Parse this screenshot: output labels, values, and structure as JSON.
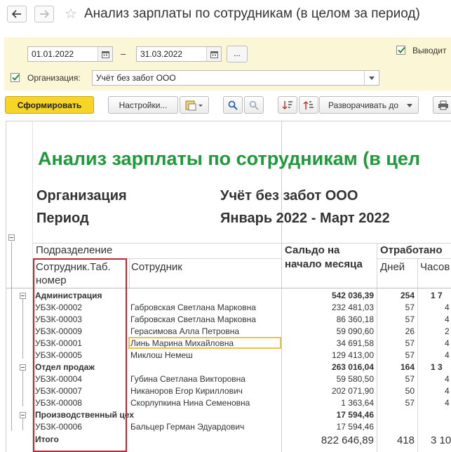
{
  "window": {
    "title": "Анализ зарплаты по сотрудникам (в целом за период)"
  },
  "params": {
    "date_from": "01.01.2022",
    "date_to": "31.03.2022",
    "dash": "–",
    "more_btn": "...",
    "output_label": "Выводит",
    "org_label": "Организация:",
    "org_value": "Учёт без забот ООО"
  },
  "toolbar": {
    "generate": "Сформировать",
    "settings": "Настройки...",
    "expand": "Разворачивать до"
  },
  "report": {
    "title": "Анализ зарплаты по сотрудникам (в цел",
    "org_label": "Организация",
    "org_value": "Учёт без забот ООО",
    "period_label": "Период",
    "period_value": "Январь 2022 - Март 2022",
    "columns": {
      "department": "Подразделение",
      "tab_no_1": "Сотрудник.Таб.",
      "tab_no_2": "номер",
      "employee": "Сотрудник",
      "saldo_1": "Сальдо на",
      "saldo_2": "начало месяца",
      "worked": "Отработано",
      "days": "Дней",
      "hours": "Часов"
    },
    "rows": [
      {
        "type": "group",
        "name": "Администрация",
        "saldo": "542 036,39",
        "days": "254",
        "hours": "1 7"
      },
      {
        "type": "item",
        "tab": "УБЗК-00002",
        "name": "Габровская Светлана Марковна",
        "saldo": "232 481,03",
        "days": "57",
        "hours": "4"
      },
      {
        "type": "item",
        "tab": "УБЗК-00003",
        "name": "Габровская Светлана Марковна",
        "saldo": "86 360,18",
        "days": "57",
        "hours": "4"
      },
      {
        "type": "item",
        "tab": "УБЗК-00009",
        "name": "Герасимова Алла Петровна",
        "saldo": "59 090,60",
        "days": "26",
        "hours": "2"
      },
      {
        "type": "item",
        "tab": "УБЗК-00001",
        "name": "Линь Марина Михайловна",
        "saldo": "34 691,58",
        "days": "57",
        "hours": "4"
      },
      {
        "type": "item",
        "tab": "УБЗК-00005",
        "name": "Миклош Немеш",
        "saldo": "129 413,00",
        "days": "57",
        "hours": "4"
      },
      {
        "type": "group",
        "name": "Отдел продаж",
        "saldo": "263 016,04",
        "days": "164",
        "hours": "1 3"
      },
      {
        "type": "item",
        "tab": "УБЗК-00004",
        "name": "Губина Светлана Викторовна",
        "saldo": "59 580,50",
        "days": "57",
        "hours": "4"
      },
      {
        "type": "item",
        "tab": "УБЗК-00007",
        "name": "Никаноров Егор Кириллович",
        "saldo": "202 071,90",
        "days": "50",
        "hours": "4"
      },
      {
        "type": "item",
        "tab": "УБЗК-00008",
        "name": "Скорлупкина Нина Семеновна",
        "saldo": "1 363,64",
        "days": "57",
        "hours": "4"
      },
      {
        "type": "group",
        "name": "Производственный цех",
        "saldo": "17 594,46",
        "days": "",
        "hours": ""
      },
      {
        "type": "item",
        "tab": "УБЗК-00006",
        "name": "Бальцер Герман Эдуардович",
        "saldo": "17 594,46",
        "days": "",
        "hours": ""
      }
    ],
    "total": {
      "label": "Итого",
      "saldo": "822 646,89",
      "days": "418",
      "hours": "3 10"
    }
  },
  "colors": {
    "accent_yellow": "#f6d528",
    "title_green": "#1f9a3a",
    "highlight_red": "#c0262d",
    "selected_cell": "#e8c547"
  }
}
